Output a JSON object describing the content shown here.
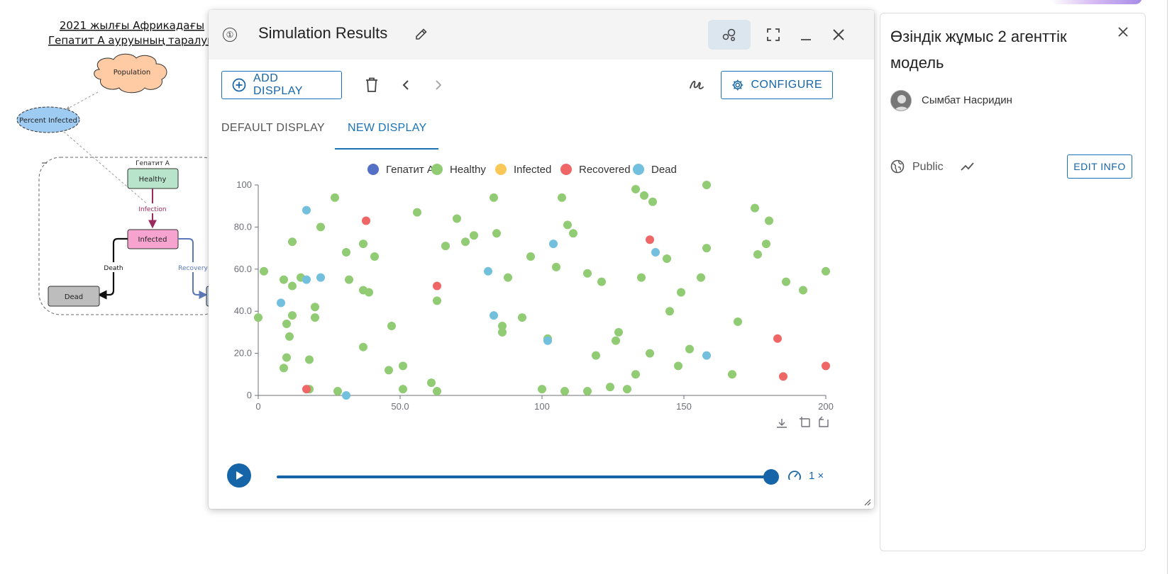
{
  "diagram": {
    "title_line1": "2021 жылғы Африкадағы",
    "title_line2": "Гепатит А ауруының таралуы",
    "population_label": "Population",
    "percent_infected_label": "Percent Infected",
    "group_label": "Гепатит А",
    "healthy_label": "Healthy",
    "infection_label": "Infection",
    "infected_label": "Infected",
    "death_label": "Death",
    "recovery_label": "Recovery",
    "dead_label": "Dead"
  },
  "sim_window": {
    "info_icon": "①",
    "title": "Simulation Results",
    "icons": [
      "pencil-icon",
      "bubble-icon",
      "fullscreen-icon",
      "minimize-icon",
      "close-icon"
    ],
    "add_display_label": "ADD DISPLAY",
    "configure_label": "CONFIGURE",
    "tabs": [
      {
        "label": "DEFAULT DISPLAY",
        "selected": false
      },
      {
        "label": "NEW DISPLAY",
        "selected": true
      }
    ],
    "playback": {
      "progress": 1.0,
      "speed_label": "1 ×"
    }
  },
  "chart_data": {
    "type": "scatter",
    "series": [
      {
        "name": "Гепатит А",
        "color": "#5470c6",
        "points": []
      },
      {
        "name": "Healthy",
        "color": "#91cc75",
        "points": [
          [
            2,
            59
          ],
          [
            0,
            37
          ],
          [
            9,
            55
          ],
          [
            12,
            73
          ],
          [
            10,
            34
          ],
          [
            11,
            28
          ],
          [
            12,
            38
          ],
          [
            12,
            52
          ],
          [
            15,
            56
          ],
          [
            9,
            13
          ],
          [
            10,
            18
          ],
          [
            18,
            17
          ],
          [
            20,
            42
          ],
          [
            20,
            37
          ],
          [
            22,
            80
          ],
          [
            27,
            94
          ],
          [
            31,
            68
          ],
          [
            32,
            55
          ],
          [
            37,
            72
          ],
          [
            37,
            50
          ],
          [
            37,
            23
          ],
          [
            39,
            49
          ],
          [
            41,
            66
          ],
          [
            46,
            12
          ],
          [
            47,
            33
          ],
          [
            51,
            14
          ],
          [
            51,
            3
          ],
          [
            56,
            87
          ],
          [
            61,
            6
          ],
          [
            63,
            45
          ],
          [
            63,
            2
          ],
          [
            66,
            71
          ],
          [
            70,
            84
          ],
          [
            73,
            73
          ],
          [
            76,
            76
          ],
          [
            83,
            94
          ],
          [
            84,
            77
          ],
          [
            86,
            33
          ],
          [
            86,
            30
          ],
          [
            88,
            56
          ],
          [
            93,
            37
          ],
          [
            96,
            66
          ],
          [
            100,
            3
          ],
          [
            102,
            27
          ],
          [
            105,
            61
          ],
          [
            107,
            94
          ],
          [
            108,
            2
          ],
          [
            109,
            81
          ],
          [
            111,
            77
          ],
          [
            116,
            58
          ],
          [
            116,
            2
          ],
          [
            119,
            19
          ],
          [
            121,
            54
          ],
          [
            124,
            4
          ],
          [
            126,
            26
          ],
          [
            127,
            30
          ],
          [
            130,
            3
          ],
          [
            133,
            10
          ],
          [
            133,
            98
          ],
          [
            135,
            56
          ],
          [
            136,
            95
          ],
          [
            138,
            20
          ],
          [
            139,
            92
          ],
          [
            144,
            65
          ],
          [
            145,
            40
          ],
          [
            148,
            14
          ],
          [
            149,
            49
          ],
          [
            152,
            22
          ],
          [
            156,
            56
          ],
          [
            158,
            100
          ],
          [
            158,
            70
          ],
          [
            167,
            10
          ],
          [
            169,
            35
          ],
          [
            175,
            89
          ],
          [
            176,
            67
          ],
          [
            179,
            72
          ],
          [
            180,
            83
          ],
          [
            186,
            54
          ],
          [
            192,
            50
          ],
          [
            200,
            59
          ],
          [
            28,
            2
          ],
          [
            18,
            3
          ]
        ]
      },
      {
        "name": "Infected",
        "color": "#fac858",
        "points": []
      },
      {
        "name": "Recovered",
        "color": "#ee6666",
        "points": [
          [
            38,
            83
          ],
          [
            17,
            3
          ],
          [
            63,
            52
          ],
          [
            138,
            74
          ],
          [
            183,
            27
          ],
          [
            185,
            9
          ],
          [
            200,
            14
          ]
        ]
      },
      {
        "name": "Dead",
        "color": "#73c0de",
        "points": [
          [
            17,
            88
          ],
          [
            8,
            44
          ],
          [
            17,
            55
          ],
          [
            22,
            56
          ],
          [
            31,
            0
          ],
          [
            81,
            59
          ],
          [
            83,
            38
          ],
          [
            102,
            26
          ],
          [
            104,
            72
          ],
          [
            140,
            68
          ],
          [
            158,
            19
          ]
        ]
      }
    ],
    "xlim": [
      0,
      200
    ],
    "ylim": [
      0,
      100
    ],
    "x_ticks": [
      "0",
      "50.0",
      "100",
      "150",
      "200"
    ],
    "y_ticks": [
      "0",
      "20.0",
      "40.0",
      "60.0",
      "80.0",
      "100"
    ],
    "legend_position": "top-center",
    "grid": false
  },
  "info_panel": {
    "title": "Өзіндік жұмыс 2 агенттік модель",
    "author": "Сымбат Насридин",
    "visibility": "Public",
    "edit_label": "EDIT INFO",
    "accent_color": "#1a73b8"
  }
}
